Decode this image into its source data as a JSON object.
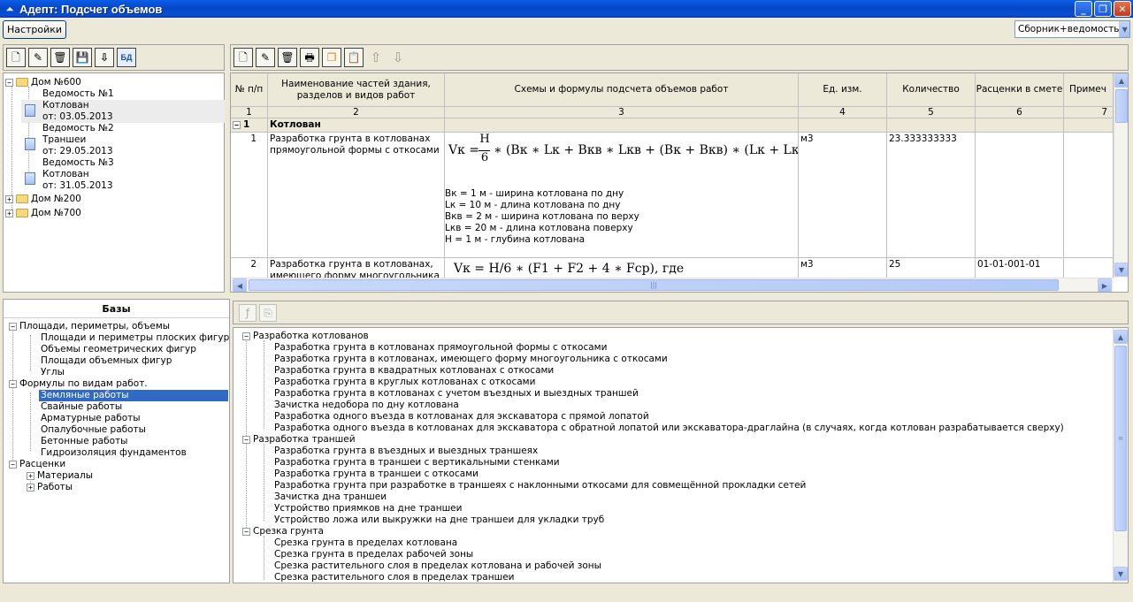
{
  "window": {
    "title": "Адепт: Подсчет объемов"
  },
  "menu": {
    "settings_label": "Настройки",
    "mode_select_value": "Сборник+ведомость"
  },
  "left_toolbar": {
    "db_label": "БД"
  },
  "project_tree": {
    "items": [
      {
        "label": "Дом №600"
      },
      {
        "label": "Ведомость №1"
      },
      {
        "label": "Котлован"
      },
      {
        "label": "от: 03.05.2013"
      },
      {
        "label": "Ведомость №2"
      },
      {
        "label": "Траншеи"
      },
      {
        "label": "от: 29.05.2013"
      },
      {
        "label": "Ведомость №3"
      },
      {
        "label": "Котлован"
      },
      {
        "label": "от: 31.05.2013"
      },
      {
        "label": "Дом №200"
      },
      {
        "label": "Дом №700"
      }
    ]
  },
  "grid": {
    "columns": [
      "№ п/п",
      "Наименование частей здания, разделов и видов работ",
      "Схемы и формулы подсчета объемов работ",
      "Ед. изм.",
      "Количество",
      "Расценки в смете",
      "Примеч"
    ],
    "col_numbers": [
      "1",
      "2",
      "3",
      "4",
      "5",
      "6",
      "7"
    ],
    "section": {
      "num": "1",
      "name": "Котлован"
    },
    "rows": [
      {
        "num": "1",
        "name": "Разработка грунта в котлованах прямоугольной формы с откосами",
        "formula_lhs": "Vк =",
        "formula_num": "H",
        "formula_den": "6",
        "formula_rhs": "∗ (Bк ∗ Lк + Bкв ∗ Lкв + (Bк + Bкв) ∗ (Lк + Lкв))",
        "params": [
          "Вк = 1 м - ширина котлована по дну",
          "Lк = 10 м - длина котлована по дну",
          "Вкв = 2 м - ширина котлована по верху",
          "Lкв = 20 м - длина котлована поверху",
          "Н = 1 м - глубина котлована"
        ],
        "unit": "м3",
        "qty": "23.333333333",
        "price": ""
      },
      {
        "num": "2",
        "name": "Разработка грунта в котлованах, имеющего форму многоугольника с откосами",
        "formula": "Vк = H/6 ∗ (F1 + F2 + 4 ∗ Fср), где",
        "unit": "м3",
        "qty": "25",
        "price": "01-01-001-01"
      }
    ]
  },
  "bases": {
    "title": "Базы",
    "items": [
      {
        "label": "Площади, периметры, объемы"
      },
      {
        "label": "Площади и периметры плоских фигур"
      },
      {
        "label": "Объемы геометрических фигур"
      },
      {
        "label": "Площади объемных фигур"
      },
      {
        "label": "Углы"
      },
      {
        "label": "Формулы по видам работ."
      },
      {
        "label": "Земляные работы"
      },
      {
        "label": "Свайные работы"
      },
      {
        "label": "Арматурные работы"
      },
      {
        "label": "Опалубочные  работы"
      },
      {
        "label": "Бетонные работы"
      },
      {
        "label": "Гидроизоляция фундаментов"
      },
      {
        "label": "Расценки"
      },
      {
        "label": "Материалы"
      },
      {
        "label": "Работы"
      }
    ]
  },
  "formulas_tree": {
    "groups": [
      {
        "label": "Разработка котлованов",
        "items": [
          "Разработка грунта в котлованах прямоугольной формы с откосами",
          "Разработка грунта в котлованах, имеющего форму многоугольника с откосами",
          "Разработка грунта в квадратных котлованах с откосами",
          "Разработка грунта в круглых котлованах с откосами",
          "Разработка грунта в котлованах с учетом въездных и выездных траншей",
          "Зачистка недобора по дну котлована",
          "Разработка  одного въезда в котлованах  для экскаватора с прямой лопатой",
          "Разработка одного въезда в котлованах для экскаватора с обратной лопатой или экскаватора-драглайна (в случаях, когда котлован разрабатывается сверху)"
        ]
      },
      {
        "label": "Разработка траншей",
        "items": [
          "Разработка грунта в въездных и выездных траншеях",
          "Разработка грунта в траншеи с вертикальными стенками",
          "Разработка грунта в траншеи с откосами",
          "Разработка грунта  при разработке в траншеях с наклонными откосами для совмещённой прокладки сетей",
          "Зачистка дна траншеи",
          "Устройство приямков на дне траншеи",
          "Устройство ложа или выкружки на дне траншеи для укладки труб"
        ]
      },
      {
        "label": "Срезка грунта",
        "items": [
          "Срезка грунта в пределах котлована",
          "Срезка грунта в пределах рабочей зоны",
          "Срезка растительного слоя  в пределах котлована и рабочей зоны",
          "Срезка растительного слоя в пределах траншеи"
        ]
      }
    ]
  }
}
